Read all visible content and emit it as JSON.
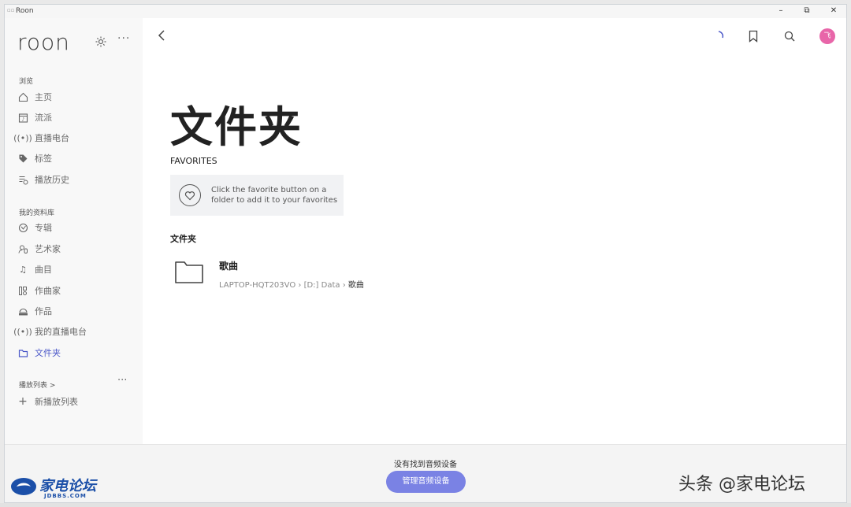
{
  "window": {
    "title": "Roon"
  },
  "titlebar": {
    "min": "–",
    "max": "⧉",
    "close": "✕"
  },
  "sidebar": {
    "logo": "roon",
    "more": "···",
    "browse_heading": "浏览",
    "browse_items": [
      {
        "label": "主页",
        "icon": "home-icon"
      },
      {
        "label": "流派",
        "icon": "genre-icon"
      },
      {
        "label": "直播电台",
        "icon": "radio-icon"
      },
      {
        "label": "标签",
        "icon": "tag-icon"
      },
      {
        "label": "播放历史",
        "icon": "history-icon"
      }
    ],
    "library_heading": "我的资料库",
    "library_items": [
      {
        "label": "专辑",
        "icon": "album-icon"
      },
      {
        "label": "艺术家",
        "icon": "artist-icon"
      },
      {
        "label": "曲目",
        "icon": "track-icon"
      },
      {
        "label": "作曲家",
        "icon": "composer-icon"
      },
      {
        "label": "作品",
        "icon": "composition-icon"
      },
      {
        "label": "我的直播电台",
        "icon": "my-radio-icon"
      },
      {
        "label": "文件夹",
        "icon": "folder-icon",
        "active": true
      }
    ],
    "playlists_heading": "播放列表 >",
    "new_playlist": "新播放列表"
  },
  "main": {
    "title": "文件夹",
    "favorites_heading": "FAVORITES",
    "favorites_hint": "Click the favorite button on a folder to add it to your favorites",
    "folders_heading": "文件夹",
    "folders": [
      {
        "name": "歌曲",
        "path_parts": [
          "LAPTOP-HQT203VO",
          "[D:] Data",
          "歌曲"
        ]
      }
    ],
    "avatar_initial": "飞"
  },
  "footer": {
    "no_device": "没有找到音频设备",
    "manage_button": "管理音频设备",
    "watermark_cn": "家电论坛",
    "watermark_en": "JDBBS.COM",
    "watermark_text": "头条 @家电论坛"
  },
  "colors": {
    "accent": "#4a57c8",
    "button": "#7a82e4",
    "avatar": "#e866a9",
    "sidebar_bg": "#f8f8f8"
  }
}
